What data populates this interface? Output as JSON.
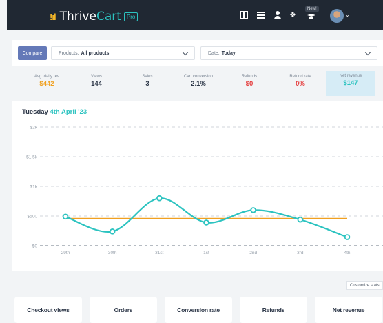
{
  "header": {
    "brand_first": "Thrive",
    "brand_second": "Cart",
    "brand_badge": "Pro",
    "new_badge": "New!",
    "icons": [
      "book-icon",
      "list-icon",
      "user-icon",
      "handshake-icon",
      "graduation-cap-icon",
      "avatar",
      "chevron-down-icon"
    ]
  },
  "filters": {
    "compare_label": "Compare",
    "products_label": "Products:",
    "products_value": "All products",
    "date_label": "Date:",
    "date_value": "Today"
  },
  "stats": [
    {
      "label": "Avg. daily rev",
      "value": "$442",
      "color": "#f0a020"
    },
    {
      "label": "Views",
      "value": "144",
      "color": "#2d3748"
    },
    {
      "label": "Sales",
      "value": "3",
      "color": "#2d3748"
    },
    {
      "label": "Cart conversion",
      "value": "2.1%",
      "color": "#2d3748"
    },
    {
      "label": "Refunds",
      "value": "$0",
      "color": "#e53e3e"
    },
    {
      "label": "Refund rate",
      "value": "0%",
      "color": "#e53e3e"
    },
    {
      "label": "Net revenue",
      "value": "$147",
      "color": "#2cc3c0"
    }
  ],
  "chart": {
    "title_prefix": "Tuesday",
    "title_highlight": "4th April '23"
  },
  "chart_data": {
    "type": "line",
    "x": [
      "29th",
      "30th",
      "31st",
      "1st",
      "2nd",
      "3rd",
      "4th"
    ],
    "series": [
      {
        "values": [
          490,
          240,
          800,
          390,
          600,
          440,
          145
        ],
        "color": "#2cc3c0"
      }
    ],
    "average_line": {
      "value": 460,
      "color": "#f0a020"
    },
    "yticks": [
      "$0",
      "$500",
      "$1k",
      "$1.5k",
      "$2k"
    ],
    "ytick_values": [
      0,
      500,
      1000,
      1500,
      2000
    ],
    "ylim": [
      0,
      2000
    ],
    "grid": true
  },
  "customize_label": "Customize stats",
  "cards": [
    "Checkout views",
    "Orders",
    "Conversion rate",
    "Refunds",
    "Net revenue"
  ]
}
